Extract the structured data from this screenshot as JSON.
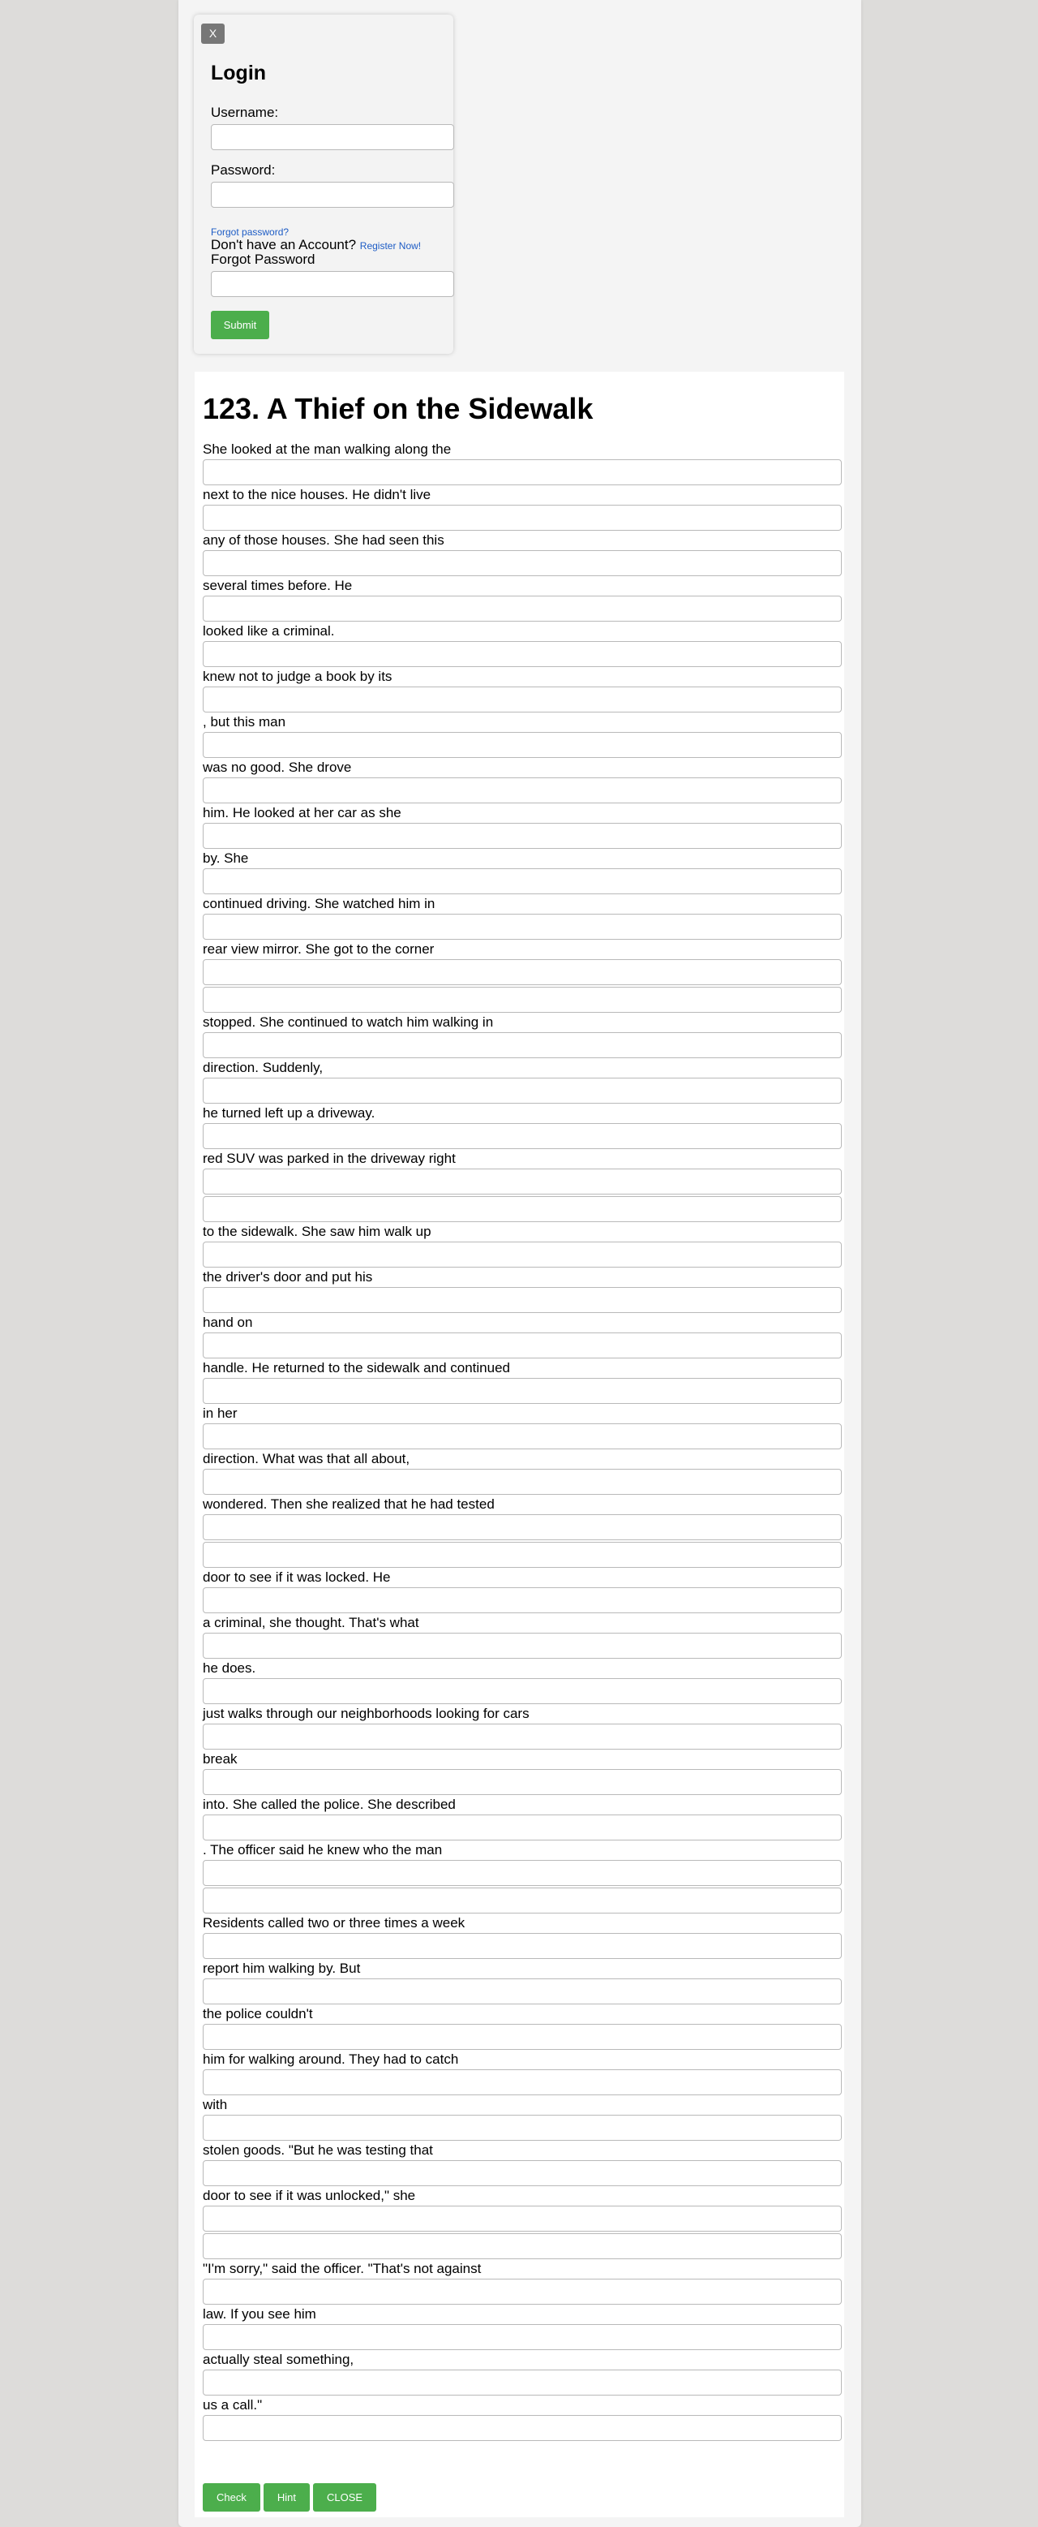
{
  "login": {
    "close_label": "X",
    "title": "Login",
    "username_label": "Username:",
    "password_label": "Password:",
    "forgot_link": "Forgot password?",
    "no_account_text": "Don't have an Account?",
    "register_link": "Register Now!",
    "forgot_heading": "Forgot Password",
    "submit_label": "Submit"
  },
  "exercise": {
    "title": "123. A Thief on the Sidewalk",
    "items": [
      {
        "text": "She looked at the man walking along the",
        "blanks": 1
      },
      {
        "text": "next to the nice houses. He didn't live",
        "blanks": 1
      },
      {
        "text": "any of those houses. She had seen this",
        "blanks": 1
      },
      {
        "text": "several times before. He",
        "blanks": 1
      },
      {
        "text": "looked like a criminal.",
        "blanks": 1
      },
      {
        "text": "knew not to judge a book by its",
        "blanks": 1
      },
      {
        "text": ", but this man",
        "blanks": 1
      },
      {
        "text": "was no good. She drove",
        "blanks": 1
      },
      {
        "text": "him. He looked at her car as she",
        "blanks": 1
      },
      {
        "text": "by. She",
        "blanks": 1
      },
      {
        "text": "continued driving. She watched him in",
        "blanks": 1
      },
      {
        "text": "rear view mirror. She got to the corner",
        "blanks": 2
      },
      {
        "text": "stopped. She continued to watch him walking in",
        "blanks": 1
      },
      {
        "text": "direction. Suddenly,",
        "blanks": 1
      },
      {
        "text": "he turned left up a driveway.",
        "blanks": 1
      },
      {
        "text": "red SUV was parked in the driveway right",
        "blanks": 2
      },
      {
        "text": "to the sidewalk. She saw him walk up",
        "blanks": 1
      },
      {
        "text": "the driver's door and put his",
        "blanks": 1
      },
      {
        "text": "hand on",
        "blanks": 1
      },
      {
        "text": "handle. He returned to the sidewalk and continued",
        "blanks": 1
      },
      {
        "text": "in her",
        "blanks": 1
      },
      {
        "text": "direction. What was that all about,",
        "blanks": 1
      },
      {
        "text": "wondered. Then she realized that he had tested",
        "blanks": 2
      },
      {
        "text": "door to see if it was locked. He",
        "blanks": 1
      },
      {
        "text": "a criminal, she thought. That's what",
        "blanks": 1
      },
      {
        "text": "he does.",
        "blanks": 1
      },
      {
        "text": "just walks through our neighborhoods looking for cars",
        "blanks": 1
      },
      {
        "text": "break",
        "blanks": 1
      },
      {
        "text": "into. She called the police. She described",
        "blanks": 1
      },
      {
        "text": ". The officer said he knew who the man",
        "blanks": 2
      },
      {
        "text": "Residents called two or three times a week",
        "blanks": 1
      },
      {
        "text": "report him walking by. But",
        "blanks": 1
      },
      {
        "text": "the police couldn't",
        "blanks": 1
      },
      {
        "text": "him for walking around. They had to catch",
        "blanks": 1
      },
      {
        "text": "with",
        "blanks": 1
      },
      {
        "text": "stolen goods. \"But he was testing that",
        "blanks": 1
      },
      {
        "text": "door to see if it was unlocked,\" she",
        "blanks": 2
      },
      {
        "text": "\"I'm sorry,\" said the officer. \"That's not against",
        "blanks": 1
      },
      {
        "text": "law. If you see him",
        "blanks": 1
      },
      {
        "text": "actually steal something,",
        "blanks": 1
      },
      {
        "text": "us a call.\"",
        "blanks": 1
      }
    ]
  },
  "buttons": {
    "check": "Check",
    "hint": "Hint",
    "close": "CLOSE"
  },
  "colors": {
    "page_bg": "#dddcda",
    "button_green": "#4cae4c",
    "link_blue": "#1d5cc5",
    "close_gray": "#777777"
  }
}
